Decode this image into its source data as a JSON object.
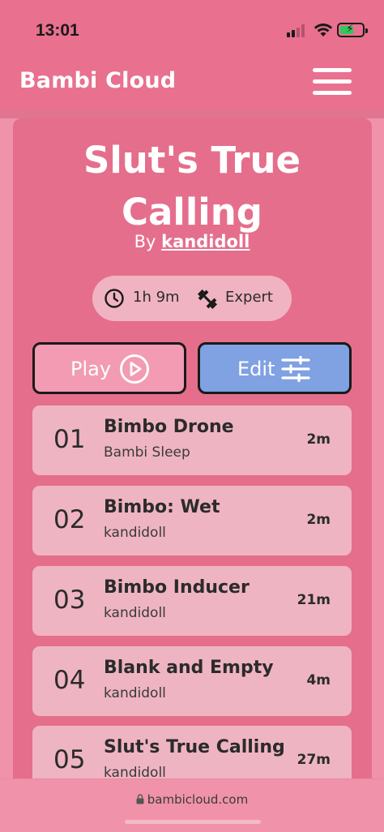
{
  "status": {
    "time": "13:01"
  },
  "header": {
    "brand": "Bambi Cloud",
    "menu_icon": "hamburger-menu-icon"
  },
  "playlist": {
    "title_line1": "Slut's True",
    "title_line2": "Calling",
    "by_label": "By",
    "author": "kandidoll",
    "duration": "1h 9m",
    "difficulty": "Expert",
    "duration_icon": "clock-icon",
    "difficulty_icon": "dumbbell-icon"
  },
  "actions": {
    "play_label": "Play",
    "edit_label": "Edit",
    "play_icon": "play-circle-icon",
    "edit_icon": "sliders-icon"
  },
  "tracks": [
    {
      "num": "01",
      "title": "Bimbo Drone",
      "artist": "Bambi Sleep",
      "duration": "2m"
    },
    {
      "num": "02",
      "title": "Bimbo: Wet",
      "artist": "kandidoll",
      "duration": "2m"
    },
    {
      "num": "03",
      "title": "Bimbo Inducer",
      "artist": "kandidoll",
      "duration": "21m"
    },
    {
      "num": "04",
      "title": "Blank and Empty",
      "artist": "kandidoll",
      "duration": "4m"
    },
    {
      "num": "05",
      "title": "Slut's True Calling",
      "artist": "kandidoll",
      "duration": "27m"
    }
  ],
  "browser": {
    "url": "bambicloud.com",
    "lock_icon": "lock-icon"
  },
  "colors": {
    "header": "#e9708e",
    "card": "#e56e8c",
    "track_bg": "#efb4c2",
    "edit_button": "#80a1e2",
    "play_button": "#f29bb2"
  }
}
